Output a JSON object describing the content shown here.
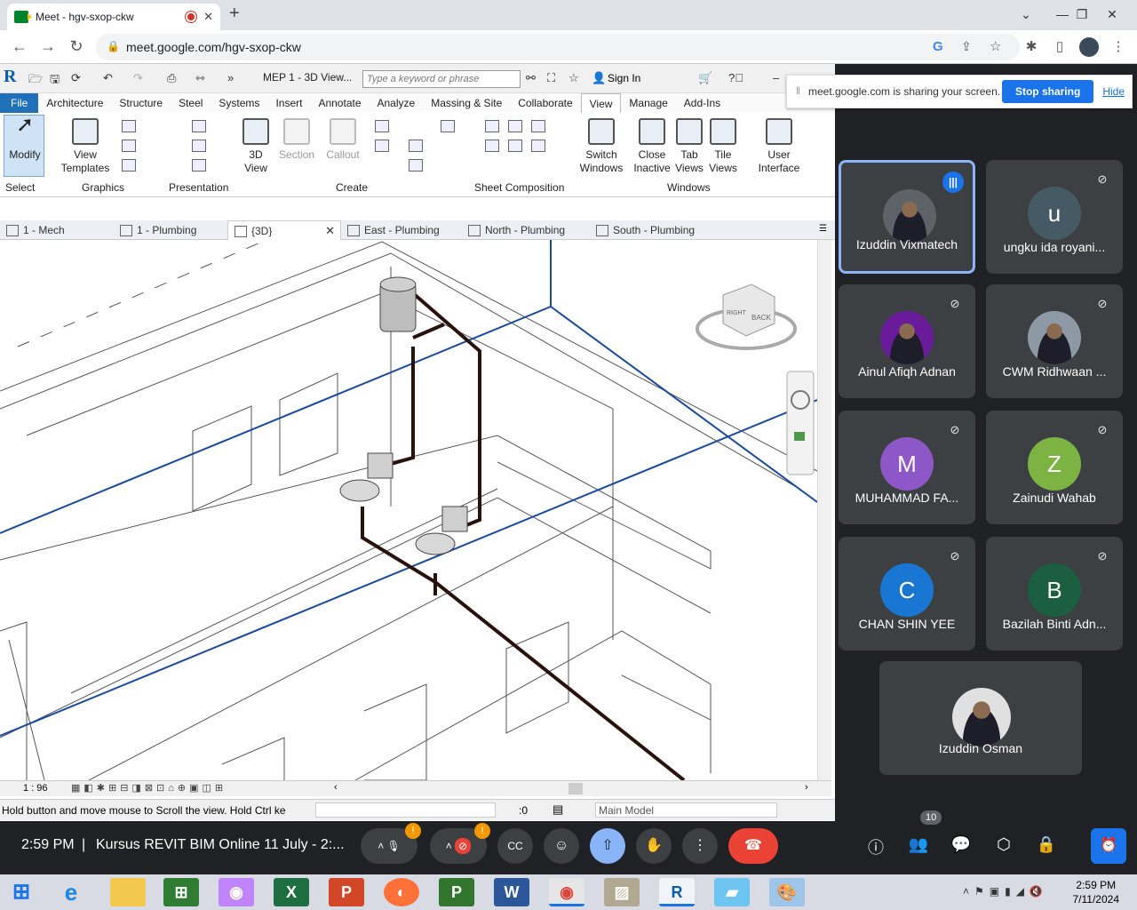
{
  "browser": {
    "tab_title": "Meet - hgv-sxop-ckw",
    "url": "meet.google.com/hgv-sxop-ckw",
    "new_tab": "+"
  },
  "revit": {
    "title": "MEP 1 - 3D View...",
    "search_placeholder": "Type a keyword or phrase",
    "sign_in": "Sign In",
    "menu": [
      "File",
      "Architecture",
      "Structure",
      "Steel",
      "Systems",
      "Insert",
      "Annotate",
      "Analyze",
      "Massing & Site",
      "Collaborate",
      "View",
      "Manage",
      "Add-Ins"
    ],
    "active_menu": "View",
    "ribbon": {
      "modify": "Modify",
      "view_templates_1": "View",
      "view_templates_2": "Templates",
      "view3d_1": "3D",
      "view3d_2": "View",
      "section": "Section",
      "callout": "Callout",
      "switch_1": "Switch",
      "switch_2": "Windows",
      "close_1": "Close",
      "close_2": "Inactive",
      "tab_1": "Tab",
      "tab_2": "Views",
      "tile_1": "Tile",
      "tile_2": "Views",
      "ui_1": "User",
      "ui_2": "Interface",
      "groups": [
        "Select",
        "Graphics",
        "Presentation",
        "Create",
        "Sheet Composition",
        "Windows"
      ]
    },
    "view_tabs": [
      "1 - Mech",
      "1 - Plumbing",
      "{3D}",
      "East - Plumbing",
      "North - Plumbing",
      "South - Plumbing"
    ],
    "scale": "1 : 96",
    "status": "Hold button and move mouse to Scroll the view. Hold Ctrl ke",
    "counter": ":0",
    "model": "Main Model",
    "viewcube_right": "RIGHT",
    "viewcube_back": "BACK"
  },
  "share_banner": {
    "text": "meet.google.com is sharing your screen.",
    "stop": "Stop sharing",
    "hide": "Hide"
  },
  "participants": [
    {
      "name": "Izuddin Vixmatech",
      "initial": "",
      "color": "#5f6368",
      "speaking": true
    },
    {
      "name": "ungku ida royani...",
      "initial": "u",
      "color": "#455a64",
      "speaking": false
    },
    {
      "name": "Ainul Afiqh Adnan",
      "initial": "",
      "color": "#6a1b9a",
      "speaking": false
    },
    {
      "name": "CWM Ridhwaan ...",
      "initial": "",
      "color": "#8d9aa5",
      "speaking": false
    },
    {
      "name": "MUHAMMAD FA...",
      "initial": "M",
      "color": "#8e57c7",
      "speaking": false
    },
    {
      "name": "Zainudi Wahab",
      "initial": "Z",
      "color": "#7cb342",
      "speaking": false
    },
    {
      "name": "CHAN SHIN YEE",
      "initial": "C",
      "color": "#1976d2",
      "speaking": false
    },
    {
      "name": "Bazilah Binti Adn...",
      "initial": "B",
      "color": "#1b5e40",
      "speaking": false
    },
    {
      "name": "Izuddin Osman",
      "initial": "",
      "color": "#e0e0e0",
      "speaking": false
    }
  ],
  "meet_bar": {
    "time": "2:59 PM",
    "meeting_title": "Kursus REVIT BIM Online 11 July - 2:...",
    "participant_count": "10"
  },
  "taskbar": {
    "time": "2:59 PM",
    "date": "7/11/2024"
  }
}
